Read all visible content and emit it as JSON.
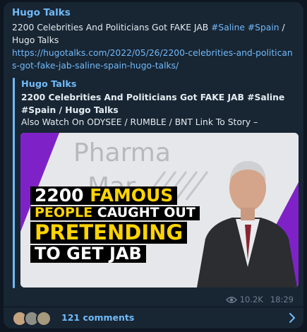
{
  "post": {
    "channel": "Hugo Talks",
    "text_main": "2200 Celebrities And Politicians Got FAKE JAB ",
    "hashtag1": "#Saline",
    "hashtag2": "#Spain",
    "text_tail": " / Hugo Talks",
    "link": "https://hugotalks.com/2022/05/26/2200-celebrities-and-politicans-got-fake-jab-saline-spain-hugo-talks/"
  },
  "preview": {
    "site": "Hugo Talks",
    "title": "2200 Celebrities And Politicians Got FAKE JAB #Saline #Spain / Hugo Talks",
    "description": "Also Watch On ODYSEE / RUMBLE / BNT Link To Story –",
    "image": {
      "logo_text_1": "Pharma",
      "logo_text_2": "Mar",
      "line1_white": "2200 ",
      "line1_yellow": "FAMOUS",
      "line2_yellow": "PEOPLE",
      "line2_white": " CAUGHT OUT",
      "line3": "PRETENDING",
      "line4": "TO GET JAB",
      "accent": "#7e22c8"
    }
  },
  "meta": {
    "views": "10.2K",
    "time": "18:29"
  },
  "comments": {
    "label": "121 comments"
  },
  "colors": {
    "link": "#71baf8",
    "bubble": "#182533",
    "background": "#0e1621"
  }
}
